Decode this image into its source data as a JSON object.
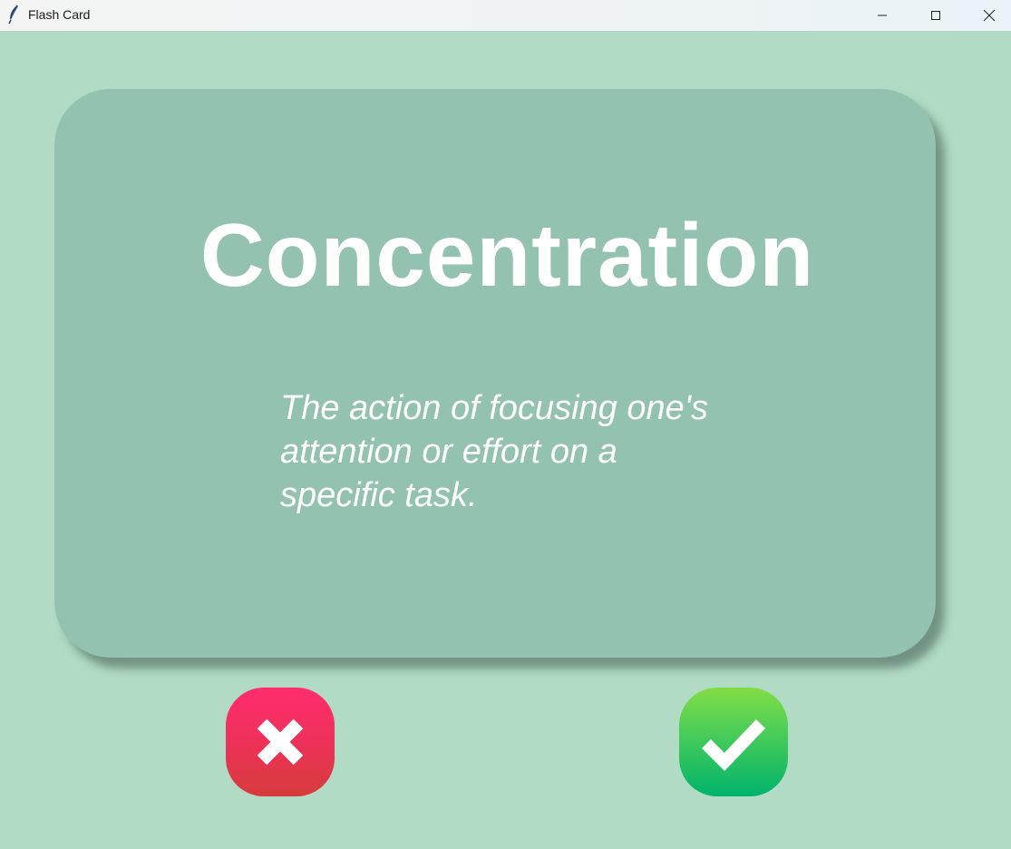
{
  "window": {
    "title": "Flash Card"
  },
  "titlebar_buttons": {
    "minimize_icon": "minimize-icon",
    "maximize_icon": "maximize-icon",
    "close_icon": "close-icon"
  },
  "card": {
    "word": "Concentration",
    "definition_lines": [
      "The action of focusing one's",
      "attention or effort on a",
      "specific task."
    ]
  },
  "buttons": {
    "wrong_icon": "cross-icon",
    "right_icon": "checkmark-icon"
  },
  "colors": {
    "background": "#b1dbc5",
    "card": "#93c2b0",
    "wrong": "#f0305c",
    "right": "#3fc95c",
    "text": "#ffffff"
  }
}
